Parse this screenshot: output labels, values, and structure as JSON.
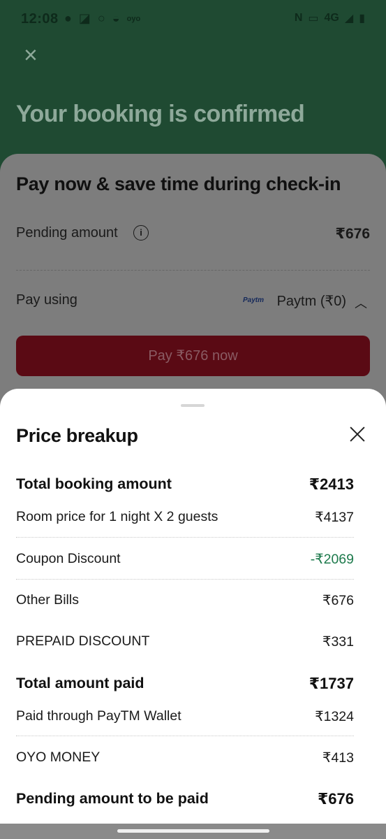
{
  "status_bar": {
    "time": "12:08",
    "left_icons": [
      "location-pin-icon",
      "app-icon",
      "search-icon",
      "food-icon",
      "oyo-icon"
    ],
    "oyo_text": "oyo",
    "right_text": "4G"
  },
  "background": {
    "header_title": "Your booking is confirmed",
    "card_title": "Pay now & save time during check-in",
    "pending_label": "Pending amount",
    "pending_value": "₹676",
    "pay_using_label": "Pay using",
    "paytm_logo": "Paytm",
    "paytm_value": "Paytm (₹0)",
    "pay_button": "Pay ₹676 now"
  },
  "sheet": {
    "title": "Price breakup",
    "rows": [
      {
        "label": "Total booking amount",
        "value": "₹2413"
      },
      {
        "label": "Room price for 1 night X 2 guests",
        "value": "₹4137"
      },
      {
        "label": "Coupon Discount",
        "value": "-₹2069"
      },
      {
        "label": "Other Bills",
        "value": "₹676"
      },
      {
        "label": "PREPAID DISCOUNT",
        "value": "₹331"
      },
      {
        "label": "Total amount paid",
        "value": "₹1737"
      },
      {
        "label": "Paid through PayTM Wallet",
        "value": "₹1324"
      },
      {
        "label": "OYO MONEY",
        "value": "₹413"
      },
      {
        "label": "Pending amount to be paid",
        "value": "₹676"
      }
    ]
  },
  "colors": {
    "header_green": "#1f4a32",
    "pay_button": "#5a0a14",
    "discount_green": "#1d7a4c"
  }
}
